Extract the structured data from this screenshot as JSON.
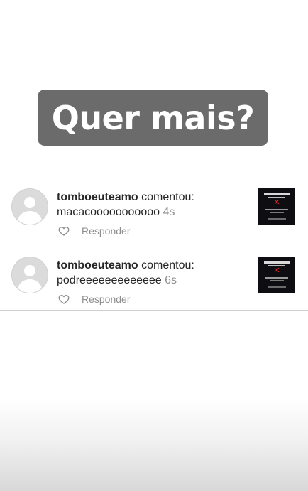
{
  "banner": {
    "text": "Quer mais?"
  },
  "comments": [
    {
      "username": "tomboeuteamo",
      "verb": "comentou:",
      "text": "macacooooooooooo",
      "time": "4s",
      "reply_label": "Responder"
    },
    {
      "username": "tomboeuteamo",
      "verb": "comentou:",
      "text": "podreeeeeeeeeeeee",
      "time": "6s",
      "reply_label": "Responder"
    }
  ],
  "colors": {
    "banner_bg": "#6b6b6b",
    "banner_text": "#ffffff",
    "username": "#262626",
    "secondary_text": "#8e8e8e",
    "avatar_bg": "#dbdbdb",
    "thumbnail_bg": "#0d0d12",
    "thumbnail_accent": "#e0282a"
  },
  "icons": {
    "like": "heart-outline-icon",
    "avatar": "default-avatar-icon"
  }
}
